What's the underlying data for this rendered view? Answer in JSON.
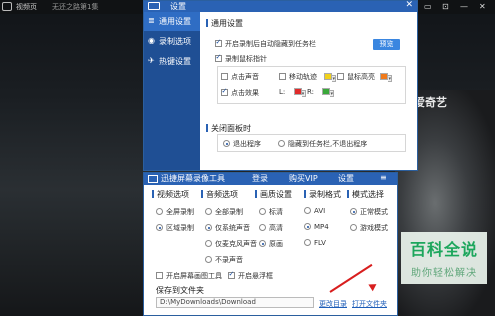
{
  "player": {
    "app_name": "视频页",
    "file_name": "无还之路第1集",
    "watermark_logo": "爱奇艺",
    "controls": [
      "▭",
      "⊡",
      "—",
      "✕"
    ]
  },
  "settings": {
    "title": "设置",
    "close": "✕",
    "sidebar": [
      {
        "icon": "≣",
        "label": "通用设置"
      },
      {
        "icon": "◉",
        "label": "录制选项"
      },
      {
        "icon": "✈",
        "label": "热键设置"
      }
    ],
    "general": {
      "section_title": "通用设置",
      "auto_hide_label": "开启录制后自动隐藏到任务栏",
      "preview_button": "预览",
      "record_pointer_label": "录制鼠标指针",
      "click_sound": "点击声音",
      "move_track": "移动轨迹",
      "mouse_highlight": "鼠标高亮",
      "click_effect": "点击效果",
      "left_label": "L:",
      "right_label": "R:",
      "colors": {
        "move_track": "#f2d21b",
        "mouse_highlight": "#f07a1a",
        "left_click": "#e02a2a",
        "right_click": "#3aa83a"
      }
    },
    "close_panel": {
      "section_title": "关闭面板时",
      "option_exit": "退出程序",
      "option_hide": "隐藏到任务栏,不退出程序"
    }
  },
  "recorder": {
    "title": "迅捷屏幕录像工具",
    "login": "登录",
    "vip": "购买VIP",
    "settings": "设置",
    "menu": "≡",
    "columns": [
      {
        "head": "视频选项",
        "options": [
          "全屏录制",
          "区域录制"
        ],
        "checked": 1
      },
      {
        "head": "音频选项",
        "options": [
          "全部录制",
          "仅系统声音",
          "仅麦克风声音",
          "不录声音"
        ],
        "checked": 1
      },
      {
        "head": "画质设置",
        "options": [
          "标清",
          "高清",
          "原画"
        ],
        "checked": 2
      },
      {
        "head": "录制格式",
        "options": [
          "AVI",
          "MP4",
          "FLV"
        ],
        "checked": 1
      },
      {
        "head": "模式选择",
        "options": [
          "正常模式",
          "游戏模式"
        ],
        "checked": 0
      }
    ],
    "screen_tool": "开启屏幕画图工具",
    "floating_window": "开启悬浮框",
    "save_folder_label": "保存到文件夹",
    "save_path": "D:\\MyDownloads\\Download",
    "change_dir": "更改目录",
    "open_folder": "打开文件夹"
  },
  "watermark": {
    "brand": "百科全说",
    "slogan": "助你轻松解决"
  }
}
